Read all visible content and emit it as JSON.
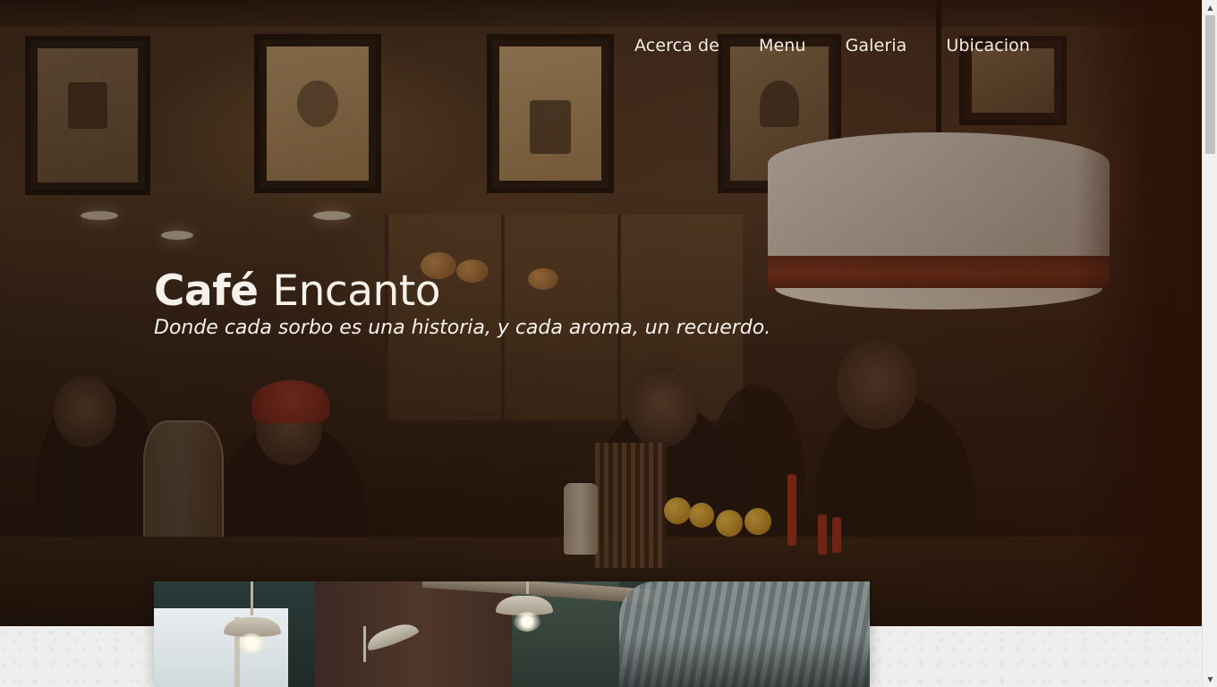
{
  "nav": {
    "items": [
      {
        "label": "Acerca de"
      },
      {
        "label": "Menu"
      },
      {
        "label": "Galeria"
      },
      {
        "label": "Ubicacion"
      }
    ]
  },
  "hero": {
    "title_strong": "Café",
    "title_light": "Encanto",
    "subtitle": "Donde cada sorbo es una historia, y cada aroma, un recuerdo."
  },
  "colors": {
    "hero_text": "#f6f1ea",
    "hero_dark": "#2c1206",
    "page_background": "#eeeeec",
    "scrollbar_thumb": "#c1c1c1"
  },
  "scrollbar": {
    "up_icon": "triangle-up-icon",
    "down_icon": "triangle-down-icon"
  }
}
